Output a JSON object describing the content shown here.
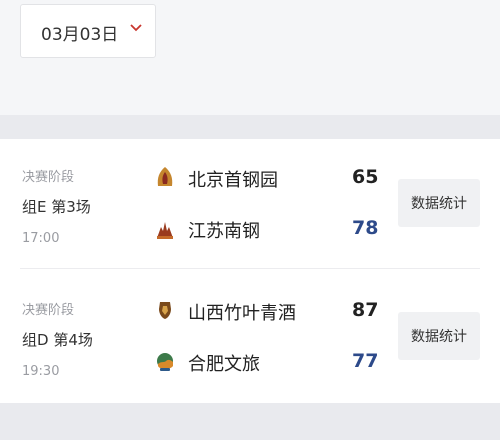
{
  "date_picker": {
    "value": "03月03日",
    "chevron_icon": "chevron-down-icon",
    "accent": "#c8362e"
  },
  "matches": [
    {
      "stage": "决赛阶段",
      "group": "组E 第3场",
      "time": "17:00",
      "teams": [
        {
          "name": "北京首钢园",
          "score": "65",
          "score_color": "#222222",
          "logo_icon": "beijing-shougang-logo-icon"
        },
        {
          "name": "江苏南钢",
          "score": "78",
          "score_color": "#2d4a8a",
          "logo_icon": "jiangsu-nangang-logo-icon"
        }
      ],
      "stats_label": "数据统计"
    },
    {
      "stage": "决赛阶段",
      "group": "组D 第4场",
      "time": "19:30",
      "teams": [
        {
          "name": "山西竹叶青酒",
          "score": "87",
          "score_color": "#222222",
          "logo_icon": "shanxi-zhuyeqing-logo-icon"
        },
        {
          "name": "合肥文旅",
          "score": "77",
          "score_color": "#2d4a8a",
          "logo_icon": "hefei-wenlv-logo-icon"
        }
      ],
      "stats_label": "数据统计"
    }
  ]
}
